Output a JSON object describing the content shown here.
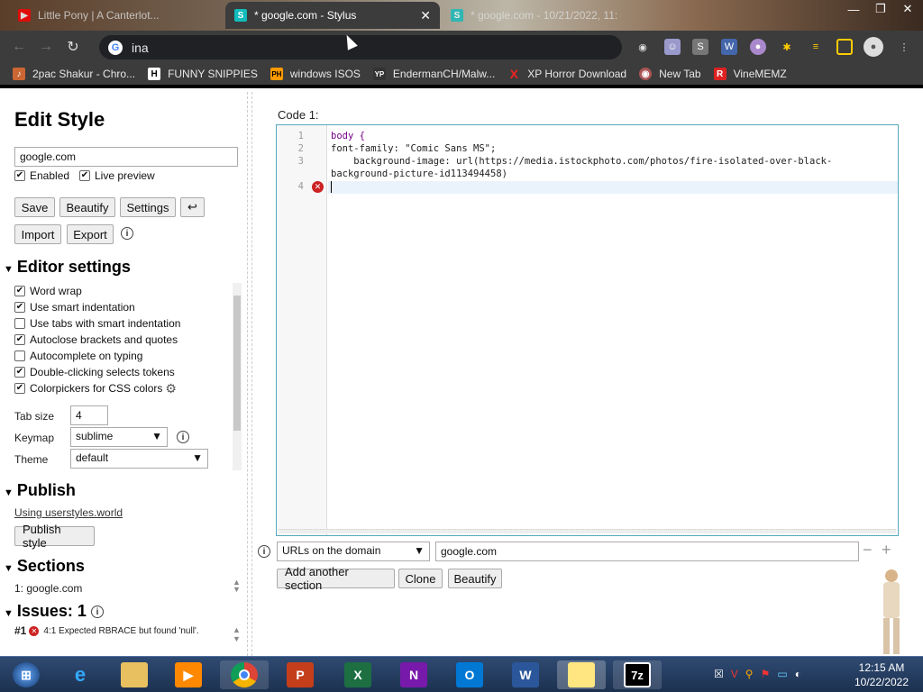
{
  "tabs": [
    {
      "title": "Little Pony | A Canterlot...",
      "icon": "youtube-icon",
      "color": "#ff0000"
    },
    {
      "title": "* google.com - Stylus",
      "icon": "stylus-icon",
      "close": "✕",
      "color": "#1bb"
    },
    {
      "title": "* google.com - 10/21/2022, 11:",
      "icon": "stylus-icon",
      "color": "#1bb"
    }
  ],
  "window_controls": {
    "minimize": "—",
    "maximize": "❐",
    "close": "✕"
  },
  "omnibox": {
    "text": "ina"
  },
  "bookmarks": [
    {
      "label": "2pac Shakur - Chro...",
      "icon": "folder-icon",
      "glyph": "♪",
      "color": "#c63"
    },
    {
      "label": "FUNNY SNIPPIES",
      "icon": "h-icon",
      "glyph": "H",
      "color": "#222"
    },
    {
      "label": "windows ISOS",
      "icon": "ph-icon",
      "glyph": "PH",
      "color": "#f90"
    },
    {
      "label": "EndermanCH/Malw...",
      "icon": "yp-icon",
      "glyph": "YP",
      "color": "#333"
    },
    {
      "label": "XP Horror Download",
      "icon": "x-icon",
      "glyph": "X",
      "color": "#e22"
    },
    {
      "label": "New Tab",
      "icon": "newtab-icon",
      "glyph": "◉",
      "color": "#a55"
    },
    {
      "label": "VineMEMZ",
      "icon": "r-icon",
      "glyph": "R",
      "color": "#d22"
    }
  ],
  "editor": {
    "title": "Edit Style",
    "name_value": "google.com",
    "enabled_label": "Enabled",
    "live_preview_label": "Live preview",
    "save": "Save",
    "beautify": "Beautify",
    "settings": "Settings",
    "undo": "↩",
    "import": "Import",
    "export": "Export"
  },
  "editor_settings": {
    "heading": "Editor settings",
    "options": [
      {
        "label": "Word wrap",
        "checked": true
      },
      {
        "label": "Use smart indentation",
        "checked": true
      },
      {
        "label": "Use tabs with smart indentation",
        "checked": false
      },
      {
        "label": "Autoclose brackets and quotes",
        "checked": true
      },
      {
        "label": "Autocomplete on typing",
        "checked": false
      },
      {
        "label": "Double-clicking selects tokens",
        "checked": true
      },
      {
        "label": "Colorpickers for CSS colors",
        "checked": true
      }
    ],
    "tab_size_label": "Tab size",
    "tab_size": "4",
    "keymap_label": "Keymap",
    "keymap": "sublime",
    "theme_label": "Theme",
    "theme": "default"
  },
  "publish": {
    "heading": "Publish",
    "link": "Using userstyles.world",
    "button": "Publish style"
  },
  "sections": {
    "heading": "Sections",
    "item": "1: google.com"
  },
  "issues": {
    "heading": "Issues: 1",
    "item_num": "#1",
    "item_text": "4:1  Expected RBRACE but found 'null'."
  },
  "code": {
    "label": "Code 1:",
    "lines": [
      {
        "n": "1",
        "text": "body {"
      },
      {
        "n": "2",
        "text": "font-family: \"Comic Sans MS\";"
      },
      {
        "n": "3",
        "text": "    background-image: url(https://media.istockphoto.com/photos/fire-isolated-over-black-"
      },
      {
        "n": "",
        "text": "background-picture-id113494458)"
      },
      {
        "n": "4",
        "text": ""
      }
    ]
  },
  "applies": {
    "type": "URLs on the domain",
    "value": "google.com",
    "add_section": "Add another section",
    "clone": "Clone",
    "beautify": "Beautify"
  },
  "clock": {
    "time": "12:15 AM",
    "date": "10/22/2022"
  }
}
